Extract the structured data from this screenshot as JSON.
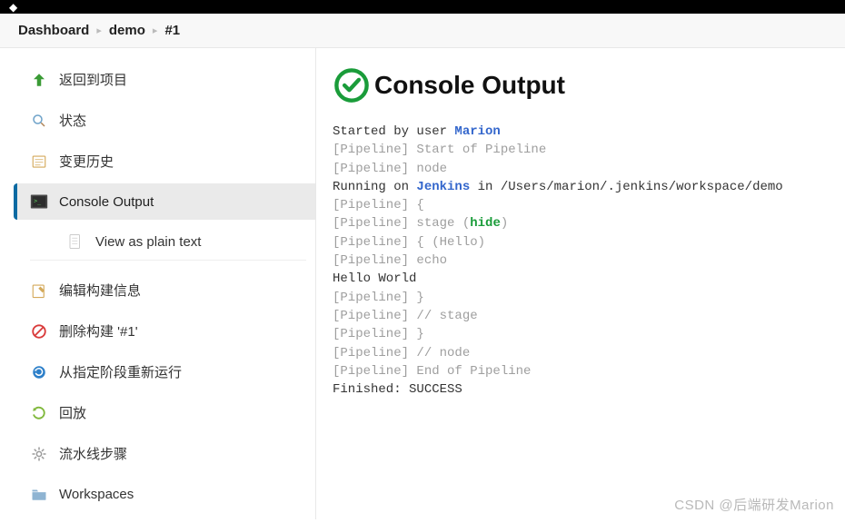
{
  "breadcrumb": {
    "items": [
      "Dashboard",
      "demo",
      "#1"
    ]
  },
  "sidebar": {
    "items": [
      {
        "icon": "up-arrow",
        "label": "返回到项目"
      },
      {
        "icon": "search",
        "label": "状态"
      },
      {
        "icon": "history",
        "label": "变更历史"
      },
      {
        "icon": "terminal",
        "label": "Console Output",
        "active": true
      },
      {
        "icon": "document",
        "label": "View as plain text",
        "sub": true
      },
      {
        "icon": "edit",
        "label": "编辑构建信息"
      },
      {
        "icon": "delete",
        "label": "删除构建 '#1'"
      },
      {
        "icon": "restart",
        "label": "从指定阶段重新运行"
      },
      {
        "icon": "replay",
        "label": "回放"
      },
      {
        "icon": "gear",
        "label": "流水线步骤"
      },
      {
        "icon": "folder",
        "label": "Workspaces"
      }
    ]
  },
  "page": {
    "title": "Console Output",
    "status": "success"
  },
  "console": {
    "lines": [
      {
        "prefix": "Started by user ",
        "link": "Marion"
      },
      {
        "muted": "[Pipeline] Start of Pipeline"
      },
      {
        "muted": "[Pipeline] node"
      },
      {
        "prefix": "Running on ",
        "link": "Jenkins",
        "suffix": " in /Users/marion/.jenkins/workspace/demo"
      },
      {
        "muted": "[Pipeline] {"
      },
      {
        "muted_prefix": "[Pipeline] stage (",
        "green": "hide",
        "muted_suffix": ")"
      },
      {
        "muted": "[Pipeline] { (Hello)"
      },
      {
        "muted": "[Pipeline] echo"
      },
      {
        "text": "Hello World"
      },
      {
        "muted": "[Pipeline] }"
      },
      {
        "muted": "[Pipeline] // stage"
      },
      {
        "muted": "[Pipeline] }"
      },
      {
        "muted": "[Pipeline] // node"
      },
      {
        "muted": "[Pipeline] End of Pipeline"
      },
      {
        "text": "Finished: SUCCESS"
      }
    ]
  },
  "watermark": "CSDN @后端研发Marion"
}
